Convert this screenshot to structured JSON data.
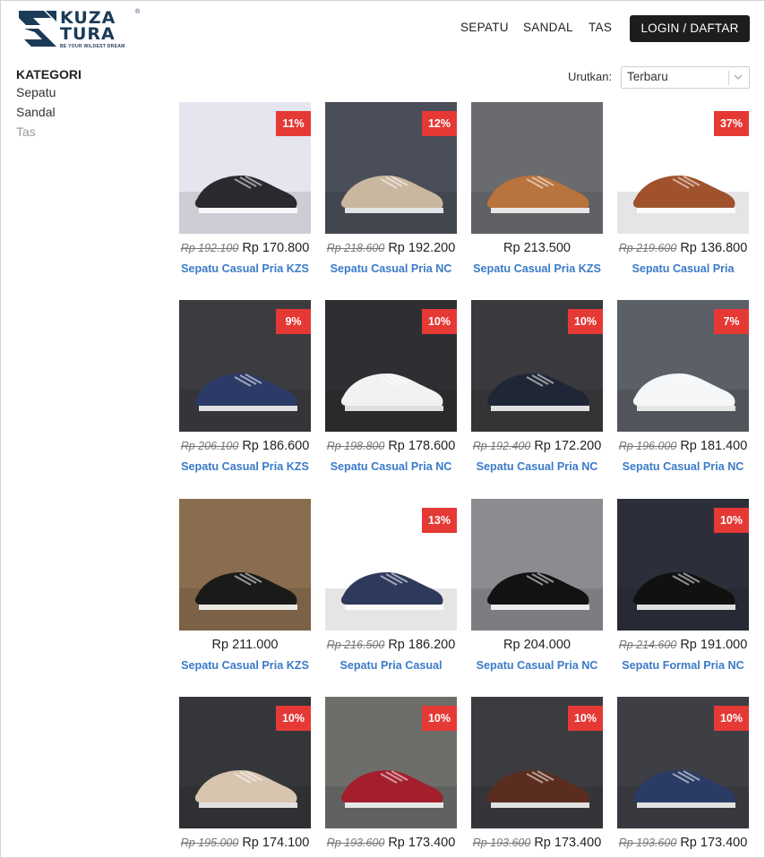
{
  "brand": {
    "word1": "KUZA",
    "word2": "TURA",
    "tagline": "BE YOUR WILDEST DREAM",
    "reg": "®",
    "color": "#1b3a57"
  },
  "nav": {
    "sepatu": "SEPATU",
    "sandal": "SANDAL",
    "tas": "TAS",
    "login": "LOGIN / DAFTAR"
  },
  "sidebar": {
    "title": "KATEGORI",
    "items": [
      "Sepatu",
      "Sandal",
      "Tas"
    ]
  },
  "sort": {
    "label": "Urutkan:",
    "value": "Terbaru"
  },
  "colors": {
    "badge": "#e53935",
    "link": "#3a7bc8",
    "button": "#1d1d1d"
  },
  "products": [
    {
      "badge": "11%",
      "old": "Rp 192.100",
      "price": "Rp 170.800",
      "name": "Sepatu Casual Pria KZS",
      "bg": "#e4e5ee",
      "shoe": "#2a2a2e"
    },
    {
      "badge": "12%",
      "old": "Rp 218.600",
      "price": "Rp 192.200",
      "name": "Sepatu Casual Pria NC",
      "bg": "#4a4e58",
      "shoe": "#c9b7a0"
    },
    {
      "badge": "",
      "old": "",
      "price": "Rp 213.500",
      "name": "Sepatu Casual Pria KZS",
      "bg": "#6a6b6f",
      "shoe": "#b9733c"
    },
    {
      "badge": "37%",
      "old": "Rp 219.600",
      "price": "Rp 136.800",
      "name": "Sepatu Casual Pria",
      "bg": "#ffffff",
      "shoe": "#a0522d"
    },
    {
      "badge": "9%",
      "old": "Rp 206.100",
      "price": "Rp 186.600",
      "name": "Sepatu Casual Pria KZS",
      "bg": "#3c3c40",
      "shoe": "#2b3a66"
    },
    {
      "badge": "10%",
      "old": "Rp 198.800",
      "price": "Rp 178.600",
      "name": "Sepatu Casual Pria NC",
      "bg": "#2f2f33",
      "shoe": "#f2f2f2"
    },
    {
      "badge": "10%",
      "old": "Rp 192.400",
      "price": "Rp 172.200",
      "name": "Sepatu Casual Pria NC",
      "bg": "#3a3a3e",
      "shoe": "#1f2635"
    },
    {
      "badge": "7%",
      "old": "Rp 196.000",
      "price": "Rp 181.400",
      "name": "Sepatu Casual Pria NC",
      "bg": "#5b5f66",
      "shoe": "#f4f6f8"
    },
    {
      "badge": "",
      "old": "",
      "price": "Rp 211.000",
      "name": "Sepatu Casual Pria KZS",
      "bg": "#8a6c4e",
      "shoe": "#1a1a1a"
    },
    {
      "badge": "13%",
      "old": "Rp 216.500",
      "price": "Rp 186.200",
      "name": "Sepatu Pria Casual",
      "bg": "#ffffff",
      "shoe": "#2d3a5c"
    },
    {
      "badge": "",
      "old": "",
      "price": "Rp 204.000",
      "name": "Sepatu Casual Pria NC",
      "bg": "#8a8c90",
      "shoe": "#121212"
    },
    {
      "badge": "10%",
      "old": "Rp 214.600",
      "price": "Rp 191.000",
      "name": "Sepatu Formal Pria NC",
      "bg": "#2c2f3a",
      "shoe": "#111111"
    },
    {
      "badge": "10%",
      "old": "Rp 195.000",
      "price": "Rp 174.100",
      "name": "",
      "bg": "#35363a",
      "shoe": "#d8c5b0"
    },
    {
      "badge": "10%",
      "old": "Rp 193.600",
      "price": "Rp 173.400",
      "name": "",
      "bg": "#6d6e6a",
      "shoe": "#a31f2e"
    },
    {
      "badge": "10%",
      "old": "Rp 193.600",
      "price": "Rp 173.400",
      "name": "",
      "bg": "#3b3c40",
      "shoe": "#5a2d1e"
    },
    {
      "badge": "10%",
      "old": "Rp 193.600",
      "price": "Rp 173.400",
      "name": "",
      "bg": "#3e3f44",
      "shoe": "#2a3b66"
    }
  ]
}
